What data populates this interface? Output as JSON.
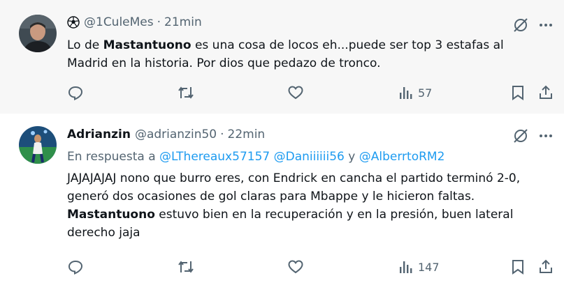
{
  "tweets": [
    {
      "user_handle": "@1CuleMes",
      "separator": "·",
      "time": "21min",
      "text_parts": [
        "Lo de ",
        "Mastantuono",
        " es una cosa de locos eh...puede ser top 3 estafas al Madrid en la historia. Por dios que pedazo de tronco."
      ],
      "views": "57"
    },
    {
      "user_name": "Adrianzin",
      "user_handle": "@adrianzin50",
      "separator": "·",
      "time": "22min",
      "reply_prefix": "En respuesta a",
      "mentions": [
        "@LThereaux57157",
        "@Daniiiiii56",
        "@AlberrtoRM2"
      ],
      "reply_connector": "y",
      "text_line1": "JAJAJAJAJ nono que burro eres, con Endrick en cancha el partido terminó 2-0, generó dos ocasiones de gol claras para Mbappe y le hicieron faltas.",
      "text_bold": "Mastantuono",
      "text_line2": " estuvo bien en la recuperación y en la presión, buen lateral derecho jaja",
      "views": "147"
    }
  ],
  "icons": {
    "reply": "reply-icon",
    "retweet": "retweet-icon",
    "like": "heart-icon",
    "views": "views-icon",
    "bookmark": "bookmark-icon",
    "share": "share-icon",
    "grok": "grok-icon",
    "more": "more-icon"
  },
  "colors": {
    "text": "#0f1419",
    "muted": "#536471",
    "link": "#1d9bf0",
    "highlight_bg": "#f7f7f7"
  }
}
